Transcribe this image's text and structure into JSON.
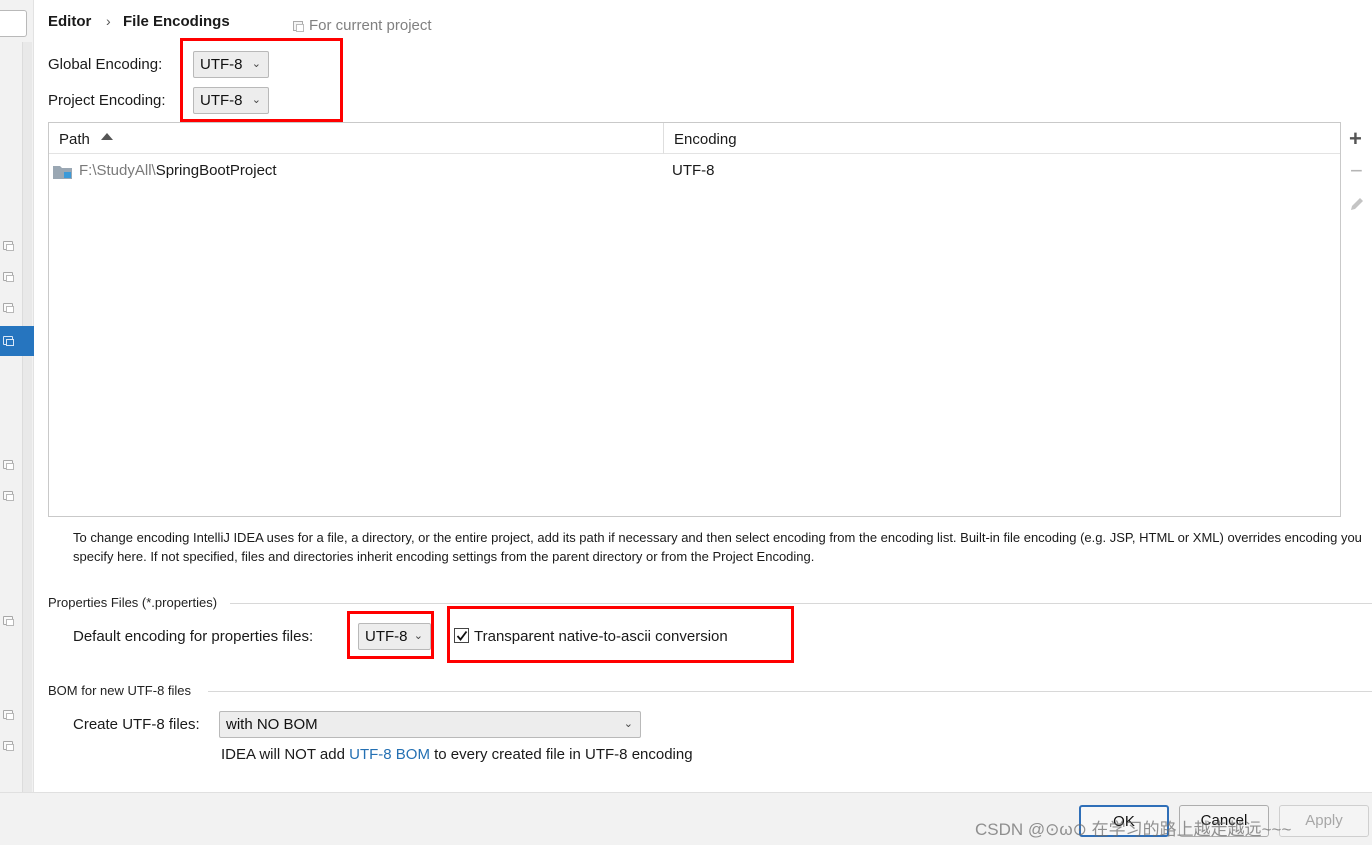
{
  "breadcrumb": {
    "parent": "Editor",
    "separator": "›",
    "current": "File Encodings",
    "scope_label": "For current project"
  },
  "encodings": {
    "global_label": "Global Encoding:",
    "global_value": "UTF-8",
    "project_label": "Project Encoding:",
    "project_value": "UTF-8"
  },
  "table": {
    "columns": [
      "Path",
      "Encoding"
    ],
    "sort_column": "Path",
    "sort_direction": "ascending",
    "rows": [
      {
        "path_prefix": "F:\\StudyAll\\",
        "path_name": "SpringBootProject",
        "encoding": "UTF-8"
      }
    ]
  },
  "toolbar": {
    "add": "+",
    "remove": "−"
  },
  "help_text": "To change encoding IntelliJ IDEA uses for a file, a directory, or the entire project, add its path if necessary and then select encoding from the encoding list. Built-in file encoding (e.g. JSP, HTML or XML) overrides encoding you specify here. If not specified, files and directories inherit encoding settings from the parent directory or from the Project Encoding.",
  "properties": {
    "group_title": "Properties Files (*.properties)",
    "default_label": "Default encoding for properties files:",
    "default_value": "UTF-8",
    "native_to_ascii_label": "Transparent native-to-ascii conversion",
    "native_to_ascii_checked": true
  },
  "bom": {
    "group_title": "BOM for new UTF-8 files",
    "create_label": "Create UTF-8 files:",
    "create_value": "with NO BOM",
    "note_before": "IDEA will NOT add ",
    "note_link": "UTF-8 BOM",
    "note_after": " to every created file in UTF-8 encoding"
  },
  "buttons": {
    "ok": "OK",
    "cancel": "Cancel",
    "apply": "Apply"
  },
  "watermark": "CSDN @⊙ω⊙ 在学习的路上越走越远~~~",
  "colors": {
    "highlight": "#ff0000",
    "selection": "#2675bf",
    "link": "#2470b3"
  },
  "icons": [
    "folder-icon",
    "sort-ascending-icon",
    "add-icon",
    "remove-icon",
    "edit-icon",
    "checkbox-checked-icon",
    "chevron-down-icon",
    "project-scope-icon"
  ]
}
